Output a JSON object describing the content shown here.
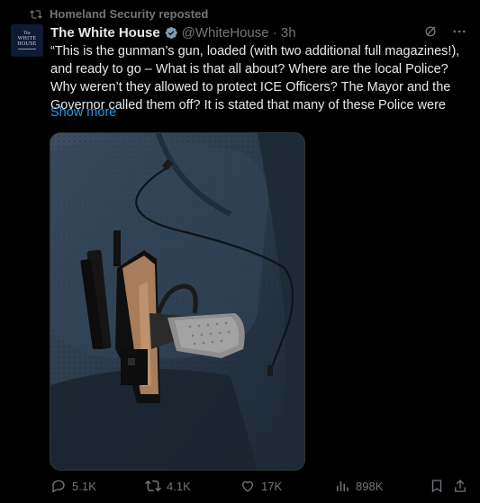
{
  "repost": {
    "icon": "repost-icon",
    "text": "Homeland Security reposted"
  },
  "avatar": {
    "line1": "The",
    "line2": "WHITE",
    "line3": "HOUSE"
  },
  "tweet": {
    "author": "The White House",
    "badge": "verified-badge-icon",
    "handle_time": "@WhiteHouse · 3h",
    "text": "“This is the gunman’s gun, loaded (with two additional full magazines!), and ready to go – What is that all about? Where are the local Police? Why weren’t they allowed to protect ICE Officers? The Mayor and the Governor called them off? It is stated that many of these Police were",
    "show_more": "Show more"
  },
  "media": {
    "icon": "photo-of-pistol-on-car-seat"
  },
  "actions": {
    "replies": "5.1K",
    "reposts": "4.1K",
    "likes": "17K",
    "views": "898K"
  },
  "colors": {
    "accent": "#1d9bf0",
    "muted": "#71767b",
    "text": "#e7e9ea",
    "background": "#000000"
  }
}
